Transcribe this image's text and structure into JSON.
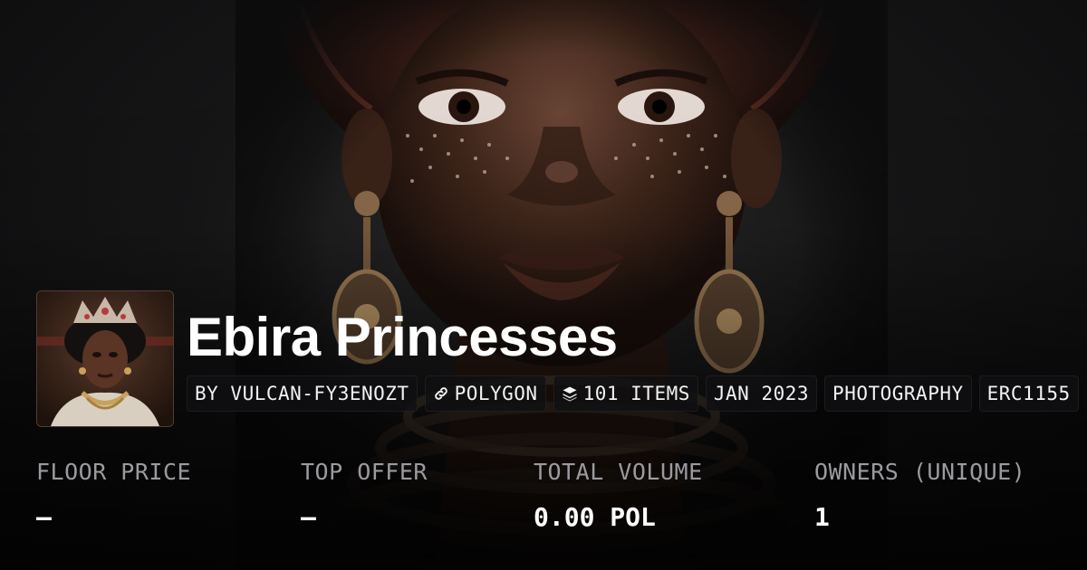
{
  "collection": {
    "name": "Ebira Princesses"
  },
  "chips": [
    {
      "label": "BY VULCAN-FY3ENOZT",
      "icon": ""
    },
    {
      "label": "POLYGON",
      "icon": "link-icon"
    },
    {
      "label": "101 ITEMS",
      "icon": "layers-icon"
    },
    {
      "label": "JAN 2023",
      "icon": ""
    },
    {
      "label": "PHOTOGRAPHY",
      "icon": ""
    },
    {
      "label": "ERC1155",
      "icon": ""
    }
  ],
  "stats": [
    {
      "label": "FLOOR PRICE",
      "value": "–"
    },
    {
      "label": "TOP OFFER",
      "value": "–"
    },
    {
      "label": "TOTAL VOLUME",
      "value": "0.00 POL"
    },
    {
      "label": "OWNERS (UNIQUE)",
      "value": "1"
    }
  ],
  "colors": {
    "background": "#0f0f10",
    "chip_bg": "#101012",
    "label": "#9b9b9f",
    "value": "#ffffff"
  }
}
